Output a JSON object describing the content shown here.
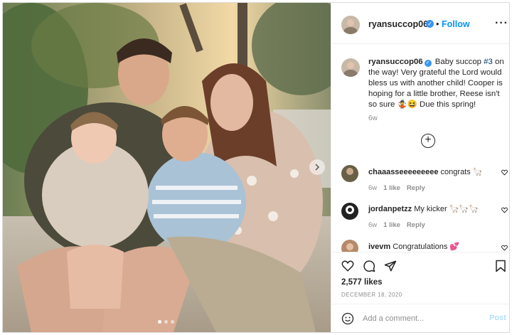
{
  "header": {
    "username": "ryansuccop06",
    "separator": "•",
    "follow_label": "Follow",
    "more_label": "···"
  },
  "caption": {
    "username": "ryansuccop06",
    "text_part1": "Baby succop ",
    "hashtag": "#3",
    "text_part2": " on the way! Very grateful the Lord would bless us with another child! Cooper is hoping for a little brother, Reese isn't so sure 🤹😆 Due this spring!",
    "time": "6w"
  },
  "load_more_label": "+",
  "comments": [
    {
      "username": "chaaasseeeeeeeee",
      "text": "congrats 🦙",
      "time": "6w",
      "likes": "1 like",
      "reply": "Reply"
    },
    {
      "username": "jordanpetzz",
      "text": "My kicker 🦙🦙🦙",
      "time": "6w",
      "likes": "1 like",
      "reply": "Reply"
    },
    {
      "username": "ivevm",
      "text": "Congratulations 💕",
      "time": "",
      "likes": "",
      "reply": ""
    }
  ],
  "likes_count": "2,577 likes",
  "post_date": "DECEMBER 18, 2020",
  "add_comment": {
    "placeholder": "Add a comment...",
    "post_label": "Post"
  },
  "colors": {
    "link_blue": "#0095f6",
    "verified_blue": "#3897f0",
    "post_disabled": "#b2dffc",
    "muted": "#8e8e8e"
  },
  "icons": [
    "verified-icon",
    "more-icon",
    "add-circle-icon",
    "heart-icon",
    "comment-icon",
    "share-icon",
    "bookmark-icon",
    "emoji-icon",
    "chevron-right-icon"
  ]
}
